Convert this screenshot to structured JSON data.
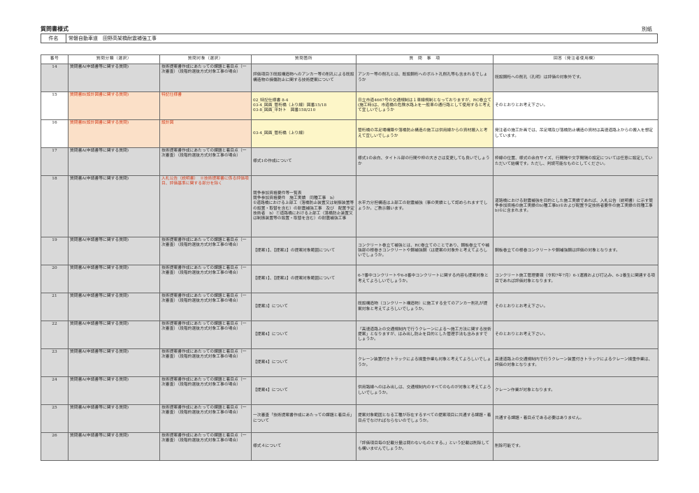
{
  "header": {
    "title": "質問書様式",
    "attachment": "別紙",
    "subject_label": "件名",
    "subject_value": "常磐自動車道　田野高架橋耐震補強工事"
  },
  "columns": [
    "番号",
    "質問分類（選択）",
    "質問対象（選択）",
    "質問箇所",
    "質　問　事　項",
    "回答（発注者使用欄）"
  ],
  "rows": [
    {
      "no": "14",
      "category": "質問書A(申請書等に関する質問)",
      "target": "技術提案書作成にあたっての課題と着目点（一次審査）（段階的選抜方式対象工事の場合）",
      "location": "評価項目③既設構造物へのアンカー等の削孔による既設構造物の損傷防止に関する技術提案について",
      "question": "アンカー等の削孔とは、既設鋼桁へのボルト孔削孔等も含まれるでしょうか",
      "answer": "既設鋼桁への削孔（孔明）は評価の対象外です。",
      "hl": false
    },
    {
      "no": "15",
      "category": "質問書B(設計図書に関する質問)",
      "target": "特記仕様書",
      "location": "02_特記仕様書 8-4\n03-4_図面_管桁橋（上り線）図番15/18\n03-8_図面_平計ト　図番158/210",
      "question": "日立市道4667号の交通規制は１車線規制となっておりますが、RC巻立て(施工時)は、市道橋の危険水路上を一般車の通行路として使用すると考えて宜しいでしょうか",
      "answer": "そのとおりとお考え下さい。",
      "hl": true
    },
    {
      "no": "16",
      "category": "質問書B(設計図書に関する質問)",
      "target": "設計図",
      "location": "03-4_図面_管桁橋（上り線）",
      "question": "管桁橋の吊足場構築や落橋防止構造の施工は供用線からの資材搬入と考えて宜しいでしょうか",
      "answer": "発注者の施工計画では、吊足場及び落橋防止構造の資材は高速道路上からの搬入を想定しています。",
      "hl": true
    },
    {
      "no": "17",
      "category": "質問書A(申請書等に関する質問)",
      "target": "技術提案書作成にあたっての課題と着目点（一次審査）（段階的選抜方式対象工事の場合）",
      "location": "様式1の作成について",
      "question": "様式1の余白、タイトル部の行間や枠の大きさは変更しても良いでしょうか",
      "answer": "枠線の位置、様式の余白サイズ、行間隔や文字間隔の設定については任意に設定していただいて結構です。ただし、判読可能なものとしてください。",
      "hl": false
    },
    {
      "no": "18",
      "category": "質問書A(申請書等に関する質問)",
      "target": "入札公告（説明書）　※技術提案書に係る評価項目、評価基準に関する部分を除く",
      "location": "競争参加資格要件等一覧表\n競争参加資格要件　施工実績　同種工事　b）\n①道路橋における上部工（落橋防止装置又は制振装置等の設置・取替を含む）の耐震補強工事　及び　配置予定技術者　b）①道路橋における上部工（落橋防止装置又は制振装置等の設置・取替を含む）の耐震補強工事",
      "question": "水平力分担構造は上部工の耐震補強（事の実績として認められますでしょうか。ご教示願います。",
      "answer": "道路橋における耐震補強を目的とした施工実績であれば、入札公告（説明書）に示す競争参加資格の施工実績のb)種工事b)①および配置予定技術者要件の施工実績の同種工事b)①に含まれます。",
      "hl": false,
      "redTarget": true
    },
    {
      "no": "19",
      "category": "質問書A(申請書等に関する質問)",
      "target": "技術提案書作成にあたっての課題と着目点（一次審査）（段階的選抜方式対象工事の場合）",
      "location": "【提案1】、【提案2】の提案対象範囲について",
      "question": "コンクリート巻立て補強とは、RC巻立てのことであり、鋼板巻立てや補強部の根巻きコンクリートや鋼補強鋼（は提案の対象外と考えてよろしいでしょうか。",
      "answer": "鋼板巻立ての根巻コンクリートや鋼補強鋼は評価の対象となります。",
      "hl": false
    },
    {
      "no": "20",
      "category": "質問書A(申請書等に関する質問)",
      "target": "技術提案書作成にあたっての課題と着目点（一次審査）（段階的選抜方式対象工事の場合）",
      "location": "【提案1】、【提案2】の提案対象範囲について",
      "question": "6-7番中コンクリートや6-8番中コンクリートに関する内容も提案対象と考えてよろしいでしょうか。",
      "answer": "コンクリート施工管理要領（令和7年7月）6-1運搬および打込み、6-2養生に関連する項目であれば評価対象となります。",
      "hl": false
    },
    {
      "no": "21",
      "category": "質問書A(申請書等に関する質問)",
      "target": "技術提案書作成にあたっての課題と着目点（一次審査）（段階的選抜方式対象工事の場合）",
      "location": "【提案3】について",
      "question": "既設構造物（コンクリート構造物）に施工する全てのアンカー削孔が提案対象と考えてよろしいでしょうか。",
      "answer": "そのとおりとお考え下さい。",
      "hl": false
    },
    {
      "no": "22",
      "category": "質問書A(申請書等に関する質問)",
      "target": "技術提案書作成にあたっての課題と着目点（一次審査）（段階的選抜方式対象工事の場合）",
      "location": "【提案4】について",
      "question": "「高速道路上の交通規制内で行うクレーンによる～施工方法に関する技術提案」となりますが、はみ出し防止を目的とした管理手法も含みますでしょうか。",
      "answer": "そのとおりとお考え下さい。",
      "hl": false
    },
    {
      "no": "23",
      "category": "質問書A(申請書等に関する質問)",
      "target": "技術提案書作成にあたっての課題と着目点（一次審査）（段階的選抜方式対象工事の場合）",
      "location": "【提案4】について",
      "question": "クレーン装置付きトラックによる揚重作業も対象と考えてよろしいでしょうか。",
      "answer": "高速道路上の交通規制内で行うクレーン装置付きトラックによるクレーン揚重作業は、評価の対象となります。",
      "hl": false
    },
    {
      "no": "24",
      "category": "質問書A(申請書等に関する質問)",
      "target": "技術提案書作成にあたっての課題と着目点（一次審査）（段階的選抜方式対象工事の場合）",
      "location": "【提案4】について",
      "question": "供用路線へのはみ出しは、交通規制内のすべてのものが対象と考えてよろしいでしょうか。",
      "answer": "クレーン作業が対象となります。",
      "hl": false
    },
    {
      "no": "25",
      "category": "質問書A(申請書等に関する質問)",
      "target": "技術提案書作成にあたっての課題と着目点（一次審査）（段階的選抜方式対象工事の場合）",
      "location": "一次審査「技術提案書作成にあたっての課題と着目点」について",
      "question": "提案対象範囲となる工種が存在するすべての提案項目に共通する課題・着目点でなければならないのでしょうか。",
      "answer": "共通する課題・着目点である必要はありません。",
      "hl": false
    },
    {
      "no": "26",
      "category": "質問書A(申請書等に関する質問)",
      "target": "技術提案書作成にあたっての課題と着目点（一次審査）（段階的選抜方式対象工事の場合）",
      "location": "様式４について",
      "question": "「評価項目毎の記載分量は問わないものとする。」という記載は削除しても構いませんでしょうか。",
      "answer": "削除可能です。",
      "hl": false
    }
  ]
}
